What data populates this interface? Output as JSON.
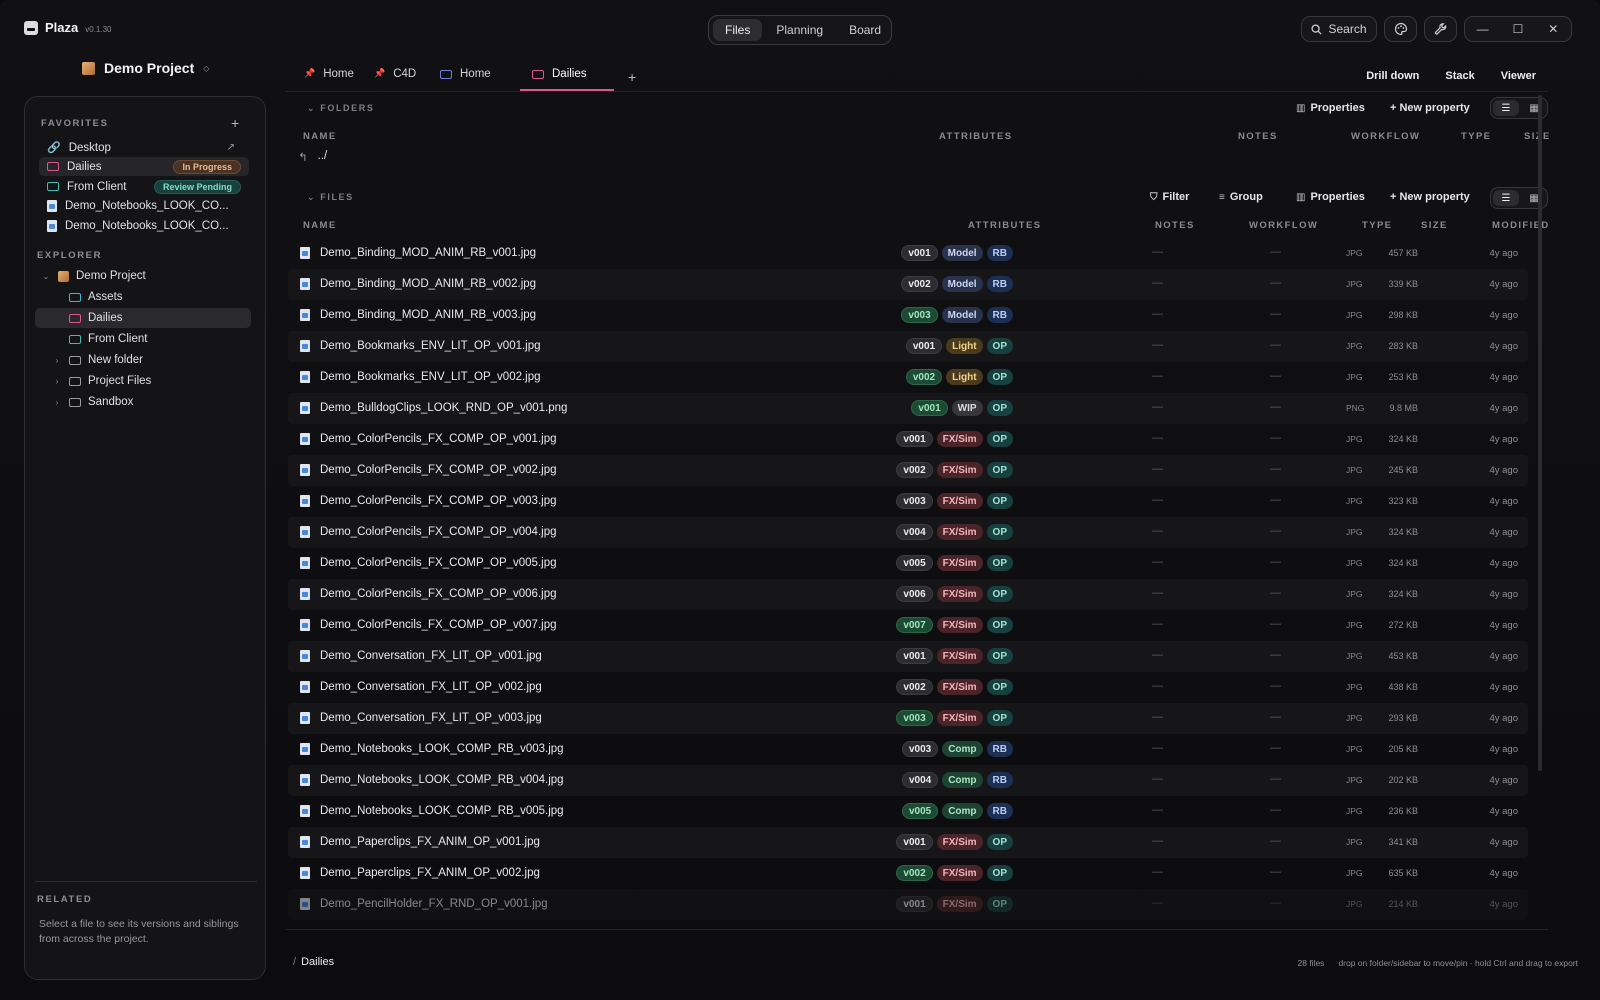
{
  "app": {
    "name": "Plaza",
    "version": "v0.1.30"
  },
  "modes": [
    "Files",
    "Planning",
    "Board"
  ],
  "active_mode": "Files",
  "titlebar": {
    "search_label": "Search",
    "icons": [
      "palette-icon",
      "wrench-icon"
    ],
    "window_controls": [
      "minimize-icon",
      "maximize-icon",
      "close-icon"
    ]
  },
  "project": {
    "name": "Demo Project"
  },
  "sidebar": {
    "favorites_label": "FAVORITES",
    "favorites": [
      {
        "label": "Desktop",
        "icon": "link-icon"
      },
      {
        "label": "Dailies",
        "icon": "folder-icon",
        "badge": "In Progress",
        "selected": true
      },
      {
        "label": "From Client",
        "icon": "folder-icon",
        "badge": "Review Pending"
      },
      {
        "label": "Demo_Notebooks_LOOK_CO...",
        "icon": "image-file-icon"
      },
      {
        "label": "Demo_Notebooks_LOOK_CO...",
        "icon": "image-file-icon"
      }
    ],
    "explorer_label": "EXPLORER",
    "tree": [
      {
        "label": "Demo Project"
      },
      {
        "label": "Assets"
      },
      {
        "label": "Dailies"
      },
      {
        "label": "From Client"
      },
      {
        "label": "New folder"
      },
      {
        "label": "Project Files"
      },
      {
        "label": "Sandbox"
      }
    ],
    "related_label": "RELATED",
    "related_text": "Select a file to see its versions and siblings from across the project."
  },
  "tabs": [
    {
      "label": "Home"
    },
    {
      "label": "C4D"
    },
    {
      "label": "Home"
    },
    {
      "label": "Dailies"
    }
  ],
  "view_links": [
    "Drill down",
    "Stack",
    "Viewer"
  ],
  "folders_section": {
    "label": "FOLDERS",
    "properties": "Properties",
    "new_property": "+ New property",
    "columns": [
      "NAME",
      "ATTRIBUTES",
      "NOTES",
      "WORKFLOW",
      "TYPE",
      "SIZE"
    ],
    "parent": "../"
  },
  "files_section": {
    "label": "FILES",
    "filter": "Filter",
    "group": "Group",
    "properties": "Properties",
    "new_property": "+ New property",
    "columns": [
      "NAME",
      "ATTRIBUTES",
      "NOTES",
      "WORKFLOW",
      "TYPE",
      "SIZE",
      "MODIFIED"
    ],
    "files": [
      {
        "name": "Demo_Binding_MOD_ANIM_RB_v001.jpg",
        "version": "v001",
        "dept": "Model",
        "tag": "RB",
        "type": "JPG",
        "size": "457 KB",
        "modified": "4y ago"
      },
      {
        "name": "Demo_Binding_MOD_ANIM_RB_v002.jpg",
        "version": "v002",
        "dept": "Model",
        "tag": "RB",
        "type": "JPG",
        "size": "339 KB",
        "modified": "4y ago"
      },
      {
        "name": "Demo_Binding_MOD_ANIM_RB_v003.jpg",
        "version": "v003",
        "dept": "Model",
        "tag": "RB",
        "type": "JPG",
        "size": "298 KB",
        "modified": "4y ago",
        "latest": true
      },
      {
        "name": "Demo_Bookmarks_ENV_LIT_OP_v001.jpg",
        "version": "v001",
        "dept": "Light",
        "tag": "OP",
        "type": "JPG",
        "size": "283 KB",
        "modified": "4y ago"
      },
      {
        "name": "Demo_Bookmarks_ENV_LIT_OP_v002.jpg",
        "version": "v002",
        "dept": "Light",
        "tag": "OP",
        "type": "JPG",
        "size": "253 KB",
        "modified": "4y ago",
        "latest": true
      },
      {
        "name": "Demo_BulldogClips_LOOK_RND_OP_v001.png",
        "version": "v001",
        "dept": "WIP",
        "tag": "OP",
        "type": "PNG",
        "size": "9.8 MB",
        "modified": "4y ago",
        "latest": true
      },
      {
        "name": "Demo_ColorPencils_FX_COMP_OP_v001.jpg",
        "version": "v001",
        "dept": "FX/Sim",
        "tag": "OP",
        "type": "JPG",
        "size": "324 KB",
        "modified": "4y ago"
      },
      {
        "name": "Demo_ColorPencils_FX_COMP_OP_v002.jpg",
        "version": "v002",
        "dept": "FX/Sim",
        "tag": "OP",
        "type": "JPG",
        "size": "245 KB",
        "modified": "4y ago"
      },
      {
        "name": "Demo_ColorPencils_FX_COMP_OP_v003.jpg",
        "version": "v003",
        "dept": "FX/Sim",
        "tag": "OP",
        "type": "JPG",
        "size": "323 KB",
        "modified": "4y ago"
      },
      {
        "name": "Demo_ColorPencils_FX_COMP_OP_v004.jpg",
        "version": "v004",
        "dept": "FX/Sim",
        "tag": "OP",
        "type": "JPG",
        "size": "324 KB",
        "modified": "4y ago"
      },
      {
        "name": "Demo_ColorPencils_FX_COMP_OP_v005.jpg",
        "version": "v005",
        "dept": "FX/Sim",
        "tag": "OP",
        "type": "JPG",
        "size": "324 KB",
        "modified": "4y ago"
      },
      {
        "name": "Demo_ColorPencils_FX_COMP_OP_v006.jpg",
        "version": "v006",
        "dept": "FX/Sim",
        "tag": "OP",
        "type": "JPG",
        "size": "324 KB",
        "modified": "4y ago"
      },
      {
        "name": "Demo_ColorPencils_FX_COMP_OP_v007.jpg",
        "version": "v007",
        "dept": "FX/Sim",
        "tag": "OP",
        "type": "JPG",
        "size": "272 KB",
        "modified": "4y ago",
        "latest": true
      },
      {
        "name": "Demo_Conversation_FX_LIT_OP_v001.jpg",
        "version": "v001",
        "dept": "FX/Sim",
        "tag": "OP",
        "type": "JPG",
        "size": "453 KB",
        "modified": "4y ago"
      },
      {
        "name": "Demo_Conversation_FX_LIT_OP_v002.jpg",
        "version": "v002",
        "dept": "FX/Sim",
        "tag": "OP",
        "type": "JPG",
        "size": "438 KB",
        "modified": "4y ago"
      },
      {
        "name": "Demo_Conversation_FX_LIT_OP_v003.jpg",
        "version": "v003",
        "dept": "FX/Sim",
        "tag": "OP",
        "type": "JPG",
        "size": "293 KB",
        "modified": "4y ago",
        "latest": true
      },
      {
        "name": "Demo_Notebooks_LOOK_COMP_RB_v003.jpg",
        "version": "v003",
        "dept": "Comp",
        "tag": "RB",
        "type": "JPG",
        "size": "205 KB",
        "modified": "4y ago"
      },
      {
        "name": "Demo_Notebooks_LOOK_COMP_RB_v004.jpg",
        "version": "v004",
        "dept": "Comp",
        "tag": "RB",
        "type": "JPG",
        "size": "202 KB",
        "modified": "4y ago"
      },
      {
        "name": "Demo_Notebooks_LOOK_COMP_RB_v005.jpg",
        "version": "v005",
        "dept": "Comp",
        "tag": "RB",
        "type": "JPG",
        "size": "236 KB",
        "modified": "4y ago",
        "latest": true
      },
      {
        "name": "Demo_Paperclips_FX_ANIM_OP_v001.jpg",
        "version": "v001",
        "dept": "FX/Sim",
        "tag": "OP",
        "type": "JPG",
        "size": "341 KB",
        "modified": "4y ago"
      },
      {
        "name": "Demo_Paperclips_FX_ANIM_OP_v002.jpg",
        "version": "v002",
        "dept": "FX/Sim",
        "tag": "OP",
        "type": "JPG",
        "size": "635 KB",
        "modified": "4y ago",
        "latest": true
      },
      {
        "name": "Demo_PencilHolder_FX_RND_OP_v001.jpg",
        "version": "v001",
        "dept": "FX/Sim",
        "tag": "OP",
        "type": "JPG",
        "size": "214 KB",
        "modified": "4y ago"
      }
    ]
  },
  "empty_value": "—",
  "footer": {
    "path": "Dailies",
    "file_count": "28 files",
    "hint": "drop on folder/sidebar to move/pin · hold Ctrl and drag to export"
  },
  "colors": {
    "accent_pink": "#e0558e",
    "in_progress": "#e9b893",
    "review_pending": "#7fdcc9"
  }
}
